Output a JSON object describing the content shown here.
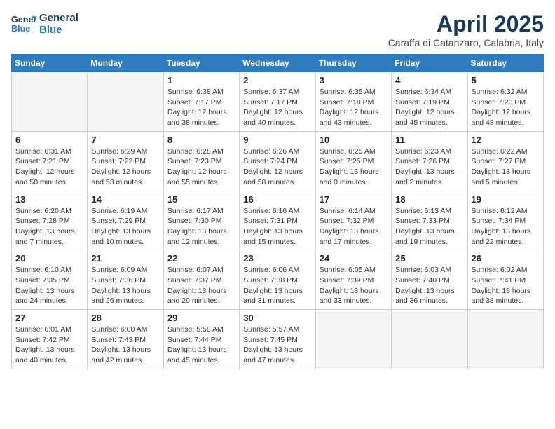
{
  "header": {
    "logo_general": "General",
    "logo_blue": "Blue",
    "month_title": "April 2025",
    "subtitle": "Caraffa di Catanzaro, Calabria, Italy"
  },
  "weekdays": [
    "Sunday",
    "Monday",
    "Tuesday",
    "Wednesday",
    "Thursday",
    "Friday",
    "Saturday"
  ],
  "weeks": [
    [
      {
        "day": "",
        "info": ""
      },
      {
        "day": "",
        "info": ""
      },
      {
        "day": "1",
        "info": "Sunrise: 6:38 AM\nSunset: 7:17 PM\nDaylight: 12 hours\nand 38 minutes."
      },
      {
        "day": "2",
        "info": "Sunrise: 6:37 AM\nSunset: 7:17 PM\nDaylight: 12 hours\nand 40 minutes."
      },
      {
        "day": "3",
        "info": "Sunrise: 6:35 AM\nSunset: 7:18 PM\nDaylight: 12 hours\nand 43 minutes."
      },
      {
        "day": "4",
        "info": "Sunrise: 6:34 AM\nSunset: 7:19 PM\nDaylight: 12 hours\nand 45 minutes."
      },
      {
        "day": "5",
        "info": "Sunrise: 6:32 AM\nSunset: 7:20 PM\nDaylight: 12 hours\nand 48 minutes."
      }
    ],
    [
      {
        "day": "6",
        "info": "Sunrise: 6:31 AM\nSunset: 7:21 PM\nDaylight: 12 hours\nand 50 minutes."
      },
      {
        "day": "7",
        "info": "Sunrise: 6:29 AM\nSunset: 7:22 PM\nDaylight: 12 hours\nand 53 minutes."
      },
      {
        "day": "8",
        "info": "Sunrise: 6:28 AM\nSunset: 7:23 PM\nDaylight: 12 hours\nand 55 minutes."
      },
      {
        "day": "9",
        "info": "Sunrise: 6:26 AM\nSunset: 7:24 PM\nDaylight: 12 hours\nand 58 minutes."
      },
      {
        "day": "10",
        "info": "Sunrise: 6:25 AM\nSunset: 7:25 PM\nDaylight: 13 hours\nand 0 minutes."
      },
      {
        "day": "11",
        "info": "Sunrise: 6:23 AM\nSunset: 7:26 PM\nDaylight: 13 hours\nand 2 minutes."
      },
      {
        "day": "12",
        "info": "Sunrise: 6:22 AM\nSunset: 7:27 PM\nDaylight: 13 hours\nand 5 minutes."
      }
    ],
    [
      {
        "day": "13",
        "info": "Sunrise: 6:20 AM\nSunset: 7:28 PM\nDaylight: 13 hours\nand 7 minutes."
      },
      {
        "day": "14",
        "info": "Sunrise: 6:19 AM\nSunset: 7:29 PM\nDaylight: 13 hours\nand 10 minutes."
      },
      {
        "day": "15",
        "info": "Sunrise: 6:17 AM\nSunset: 7:30 PM\nDaylight: 13 hours\nand 12 minutes."
      },
      {
        "day": "16",
        "info": "Sunrise: 6:16 AM\nSunset: 7:31 PM\nDaylight: 13 hours\nand 15 minutes."
      },
      {
        "day": "17",
        "info": "Sunrise: 6:14 AM\nSunset: 7:32 PM\nDaylight: 13 hours\nand 17 minutes."
      },
      {
        "day": "18",
        "info": "Sunrise: 6:13 AM\nSunset: 7:33 PM\nDaylight: 13 hours\nand 19 minutes."
      },
      {
        "day": "19",
        "info": "Sunrise: 6:12 AM\nSunset: 7:34 PM\nDaylight: 13 hours\nand 22 minutes."
      }
    ],
    [
      {
        "day": "20",
        "info": "Sunrise: 6:10 AM\nSunset: 7:35 PM\nDaylight: 13 hours\nand 24 minutes."
      },
      {
        "day": "21",
        "info": "Sunrise: 6:09 AM\nSunset: 7:36 PM\nDaylight: 13 hours\nand 26 minutes."
      },
      {
        "day": "22",
        "info": "Sunrise: 6:07 AM\nSunset: 7:37 PM\nDaylight: 13 hours\nand 29 minutes."
      },
      {
        "day": "23",
        "info": "Sunrise: 6:06 AM\nSunset: 7:38 PM\nDaylight: 13 hours\nand 31 minutes."
      },
      {
        "day": "24",
        "info": "Sunrise: 6:05 AM\nSunset: 7:39 PM\nDaylight: 13 hours\nand 33 minutes."
      },
      {
        "day": "25",
        "info": "Sunrise: 6:03 AM\nSunset: 7:40 PM\nDaylight: 13 hours\nand 36 minutes."
      },
      {
        "day": "26",
        "info": "Sunrise: 6:02 AM\nSunset: 7:41 PM\nDaylight: 13 hours\nand 38 minutes."
      }
    ],
    [
      {
        "day": "27",
        "info": "Sunrise: 6:01 AM\nSunset: 7:42 PM\nDaylight: 13 hours\nand 40 minutes."
      },
      {
        "day": "28",
        "info": "Sunrise: 6:00 AM\nSunset: 7:43 PM\nDaylight: 13 hours\nand 42 minutes."
      },
      {
        "day": "29",
        "info": "Sunrise: 5:58 AM\nSunset: 7:44 PM\nDaylight: 13 hours\nand 45 minutes."
      },
      {
        "day": "30",
        "info": "Sunrise: 5:57 AM\nSunset: 7:45 PM\nDaylight: 13 hours\nand 47 minutes."
      },
      {
        "day": "",
        "info": ""
      },
      {
        "day": "",
        "info": ""
      },
      {
        "day": "",
        "info": ""
      }
    ]
  ]
}
